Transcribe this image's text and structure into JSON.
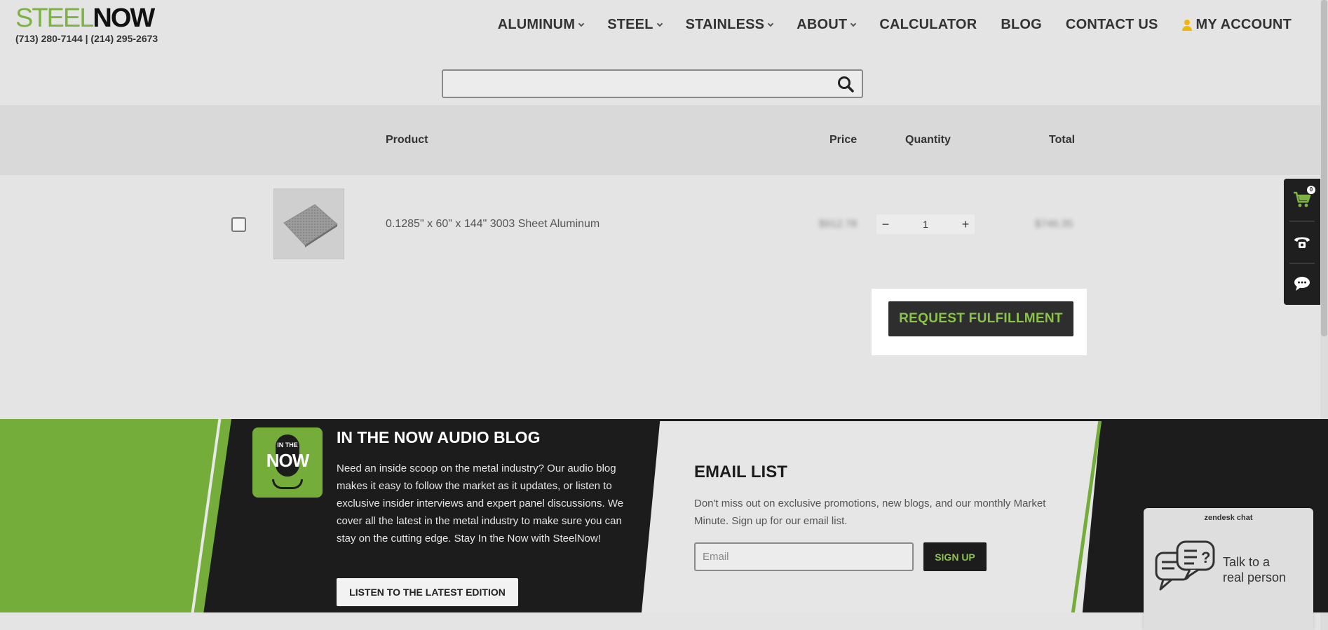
{
  "header": {
    "logo_steel": "STEEL",
    "logo_now": "NOW",
    "phones": "(713) 280-7144  |  (214) 295-2673",
    "nav": [
      {
        "label": "ALUMINUM",
        "dropdown": true
      },
      {
        "label": "STEEL",
        "dropdown": true
      },
      {
        "label": "STAINLESS",
        "dropdown": true
      },
      {
        "label": "ABOUT",
        "dropdown": true
      },
      {
        "label": "CALCULATOR",
        "dropdown": false
      },
      {
        "label": "BLOG",
        "dropdown": false
      },
      {
        "label": "CONTACT US",
        "dropdown": false
      }
    ],
    "account_label": "MY ACCOUNT",
    "account_icon": "person-icon",
    "account_icon_color": "#f2b705",
    "search": {
      "value": "",
      "placeholder": "",
      "icon": "search-icon"
    }
  },
  "cart": {
    "columns": {
      "product": "Product",
      "price": "Price",
      "quantity": "Quantity",
      "total": "Total"
    },
    "items": [
      {
        "name": "0.1285\" x 60\" x 144\" 3003 Sheet Aluminum",
        "price": "$912.78",
        "quantity": "1",
        "total": "$746.35"
      }
    ],
    "qty_minus": "−",
    "qty_plus": "+",
    "fulfill_label": "REQUEST FULFILLMENT"
  },
  "side_toolbar": {
    "cart_badge": "0",
    "items": [
      "cart-icon",
      "phone-icon",
      "chat-icon"
    ],
    "accent": "#7cb342"
  },
  "footer": {
    "blog_title": "IN THE NOW AUDIO BLOG",
    "podcast_in": "IN THE",
    "podcast_now": "NOW",
    "blog_text": "Need an inside scoop on the metal industry? Our audio blog makes it easy to follow the market as it updates, or listen to exclusive insider interviews and expert panel discussions. We cover all the latest in the metal industry to make sure you can stay on the cutting edge. Stay In the Now with SteelNow!",
    "listen_label": "LISTEN TO THE LATEST EDITION",
    "email_title": "EMAIL LIST",
    "email_text": "Don't miss out on exclusive promotions, new blogs, and our monthly Market Minute. Sign up for our email list.",
    "email_placeholder": "Email",
    "signup_label": "SIGN UP",
    "brand_green": "#75ad3a"
  },
  "chat_widget": {
    "brand": "zendesk chat",
    "line1": "Talk to a",
    "line2": "real person"
  }
}
